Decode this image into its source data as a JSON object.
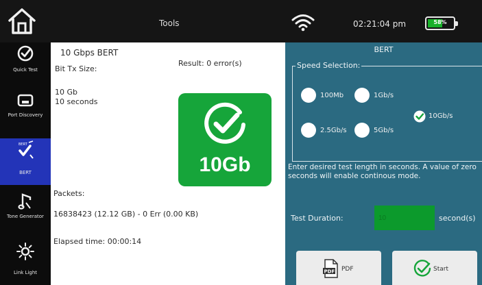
{
  "topbar": {
    "title": "Tools",
    "time": "02:21:04 pm",
    "battery_label": "58%",
    "battery_level": 0.58,
    "icons": [
      "home-icon",
      "wifi-icon",
      "battery-icon"
    ]
  },
  "sidebar": {
    "items": [
      {
        "label": "Quick Test",
        "icon": "check-circle-icon"
      },
      {
        "label": "Port Discovery",
        "icon": "port-icon"
      },
      {
        "label": "BERT",
        "icon": "bert-icon",
        "active": true
      },
      {
        "label": "Tone Generator",
        "icon": "tone-generator-icon"
      },
      {
        "label": "Link Light",
        "icon": "link-light-icon"
      }
    ]
  },
  "left": {
    "heading": "10 Gbps BERT",
    "result": "Result: 0 error(s)",
    "bit_tx_label": "Bit Tx Size:",
    "size": "10 Gb",
    "duration": "10 seconds",
    "badge_label": "10Gb",
    "packets_label": "Packets:",
    "packets_value": "16838423 (12.12 GB) - 0 Err (0.00 KB)",
    "elapsed": "Elapsed time: 00:00:14"
  },
  "right": {
    "title": "BERT",
    "speed_legend": "Speed Selection:",
    "speeds": {
      "s100mb": "100Mb",
      "s1g": "1Gb/s",
      "s10g": "10Gb/s",
      "s25g": "2.5Gb/s",
      "s5g": "5Gb/s"
    },
    "selected_speed": "10Gb/s",
    "description": "Enter desired test length in seconds. A value of zero seconds will enable continous mode.",
    "duration_label": "Test Duration:",
    "duration_value": "10",
    "duration_unit": "second(s)",
    "pdf_label": "PDF",
    "start_label": "Start"
  },
  "colors": {
    "accent_green": "#16a53a",
    "panel_teal": "#2b6a81",
    "active_blue": "#2334b8"
  }
}
